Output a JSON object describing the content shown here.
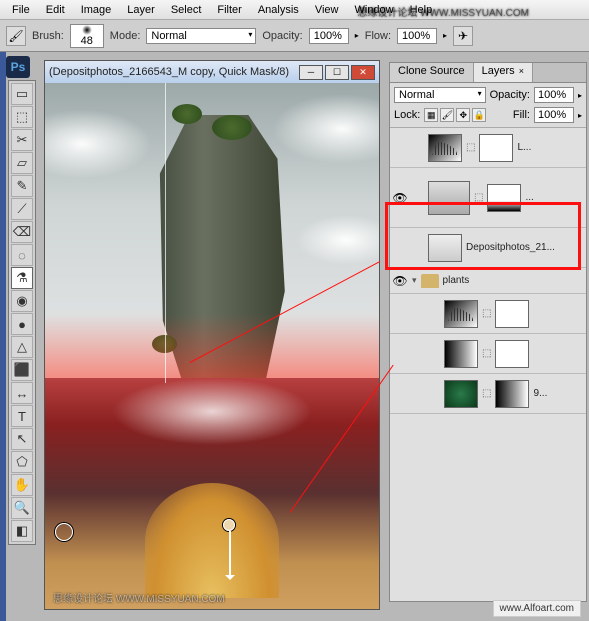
{
  "menu": [
    "File",
    "Edit",
    "Image",
    "Layer",
    "Select",
    "Filter",
    "Analysis",
    "View",
    "Window",
    "Help"
  ],
  "options": {
    "brush_label": "Brush:",
    "brush_size": "48",
    "mode_label": "Mode:",
    "mode_value": "Normal",
    "opacity_label": "Opacity:",
    "opacity_value": "100%",
    "flow_label": "Flow:",
    "flow_value": "100%"
  },
  "tools": [
    "▭",
    "⬚",
    "✂",
    "▱",
    "✎",
    "⟋",
    "⌫",
    "◌",
    "⚗",
    "◉",
    "●",
    "△",
    "⬛",
    "↔",
    "T",
    "↖",
    "⬠",
    "✋",
    "🔍",
    "◧"
  ],
  "active_tool_index": 8,
  "ps_badge": "Ps",
  "doc": {
    "title": "(Depositphotos_2166543_M copy, Quick Mask/8)"
  },
  "panel": {
    "tabs": [
      "Clone Source",
      "Layers"
    ],
    "active_tab": 1,
    "blend_mode": "Normal",
    "opacity_label": "Opacity:",
    "opacity_value": "100%",
    "lock_label": "Lock:",
    "fill_label": "Fill:",
    "fill_value": "100%",
    "layers": [
      {
        "type": "adj",
        "name": "L...",
        "eye": ""
      },
      {
        "type": "smart",
        "name": "...",
        "eye": "👁"
      },
      {
        "type": "smart",
        "name": "Depositphotos_21...",
        "eye": ""
      },
      {
        "type": "group",
        "name": "plants",
        "eye": "👁"
      },
      {
        "type": "adj",
        "name": "",
        "eye": ""
      },
      {
        "type": "adj",
        "name": "",
        "eye": ""
      },
      {
        "type": "smart",
        "name": "9...",
        "eye": ""
      }
    ]
  },
  "watermark_top": "思缘设计论坛 WWW.MISSYUAN.COM",
  "watermark_bottom": "思缘设计论坛 WWW.MISSYUAN.COM",
  "credit": "www.Alfoart.com"
}
